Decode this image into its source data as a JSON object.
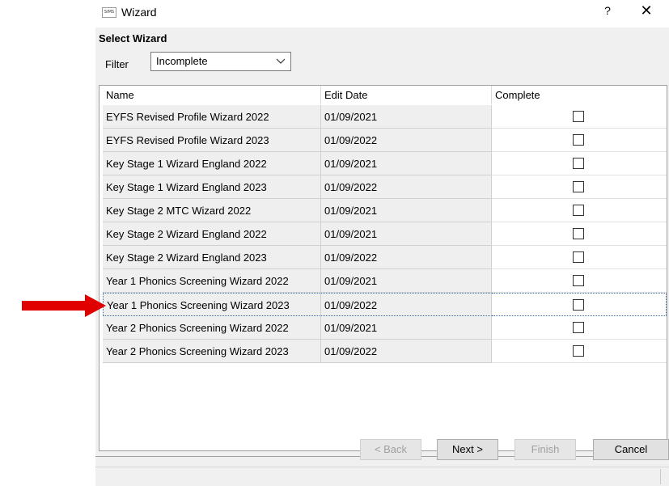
{
  "window": {
    "app_icon": "SIMS",
    "title": "Wizard",
    "help_label": "?",
    "close_label": "✕"
  },
  "section_title": "Select Wizard",
  "filter": {
    "label": "Filter",
    "selected": "Incomplete"
  },
  "grid": {
    "columns": [
      "Name",
      "Edit Date",
      "Complete"
    ],
    "rows": [
      {
        "name": "EYFS Revised Profile Wizard 2022",
        "edit_date": "01/09/2021",
        "complete": false
      },
      {
        "name": "EYFS Revised Profile Wizard 2023",
        "edit_date": "01/09/2022",
        "complete": false
      },
      {
        "name": "Key Stage 1 Wizard England 2022",
        "edit_date": "01/09/2021",
        "complete": false
      },
      {
        "name": "Key Stage 1 Wizard England 2023",
        "edit_date": "01/09/2022",
        "complete": false
      },
      {
        "name": "Key Stage 2 MTC Wizard 2022",
        "edit_date": "01/09/2021",
        "complete": false
      },
      {
        "name": "Key Stage 2 Wizard England 2022",
        "edit_date": "01/09/2021",
        "complete": false
      },
      {
        "name": "Key Stage 2 Wizard England 2023",
        "edit_date": "01/09/2022",
        "complete": false
      },
      {
        "name": "Year 1 Phonics Screening Wizard 2022",
        "edit_date": "01/09/2021",
        "complete": false
      },
      {
        "name": "Year 1 Phonics Screening Wizard 2023",
        "edit_date": "01/09/2022",
        "complete": false
      },
      {
        "name": "Year 2 Phonics Screening Wizard 2022",
        "edit_date": "01/09/2021",
        "complete": false
      },
      {
        "name": "Year 2 Phonics Screening Wizard 2023",
        "edit_date": "01/09/2022",
        "complete": false
      }
    ],
    "selected_index": 8
  },
  "buttons": {
    "back": "< Back",
    "next": "Next >",
    "finish": "Finish",
    "cancel": "Cancel"
  },
  "colors": {
    "annotation_arrow": "#e00000",
    "selection_outline": "#3a6ea5"
  },
  "icons": {
    "dropdown": "chevron-down-icon",
    "annotation": "red-arrow-icon"
  }
}
